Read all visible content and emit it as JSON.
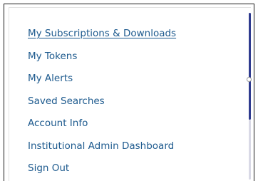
{
  "menu": {
    "items": [
      {
        "label": "My Subscriptions & Downloads",
        "active": true
      },
      {
        "label": "My Tokens",
        "active": false
      },
      {
        "label": "My Alerts",
        "active": false
      },
      {
        "label": "Saved Searches",
        "active": false
      },
      {
        "label": "Account Info",
        "active": false
      },
      {
        "label": "Institutional Admin Dashboard",
        "active": false
      },
      {
        "label": "Sign Out",
        "active": false
      }
    ]
  },
  "colors": {
    "link": "#1d5a8e",
    "scroll_thumb": "#2f3b8f",
    "border": "#1a1a1a"
  }
}
